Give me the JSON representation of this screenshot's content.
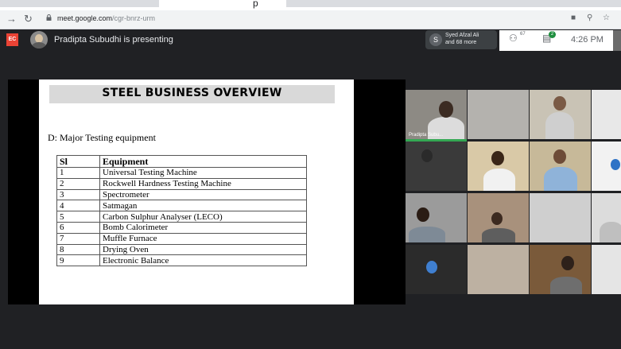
{
  "browser": {
    "tab_title": "p",
    "url_host": "meet.google.com",
    "url_path": "/cgr-bnrz-urm",
    "icons": [
      "back-icon",
      "refresh-icon",
      "lock-icon",
      "camera-icon",
      "zoom-icon",
      "star-icon"
    ]
  },
  "meet": {
    "recording_badge": "EC",
    "presenting_text": "Pradipta Subudhi is presenting",
    "participants_chip": {
      "avatar_letter": "S",
      "line1": "Syed Afzal Ali",
      "line2": "and 68 more"
    },
    "people_count": "67",
    "chat_badge": "2",
    "time": "4:26 PM"
  },
  "slide": {
    "title": "STEEL BUSINESS OVERVIEW",
    "section": "D: Major Testing equipment",
    "table": {
      "headers": [
        "Sl",
        "Equipment"
      ],
      "rows": [
        [
          "1",
          "Universal Testing Machine"
        ],
        [
          "2",
          "Rockwell Hardness Testing Machine"
        ],
        [
          "3",
          "Spectrometer"
        ],
        [
          "4",
          "Satmagan"
        ],
        [
          "5",
          "Carbon Sulphur Analyser (LECO)"
        ],
        [
          "6",
          "Bomb Calorimeter"
        ],
        [
          "7",
          "Muffle Furnace"
        ],
        [
          "8",
          "Drying Oven"
        ],
        [
          "9",
          "Electronic Balance"
        ]
      ]
    }
  },
  "video_tiles": {
    "presenter_label": "Pradipta Subu..."
  },
  "colors": {
    "meet_background": "#202124",
    "recording_red": "#ea4335",
    "presenting_green": "#34a853",
    "chat_badge_green": "#1e8e3e"
  }
}
